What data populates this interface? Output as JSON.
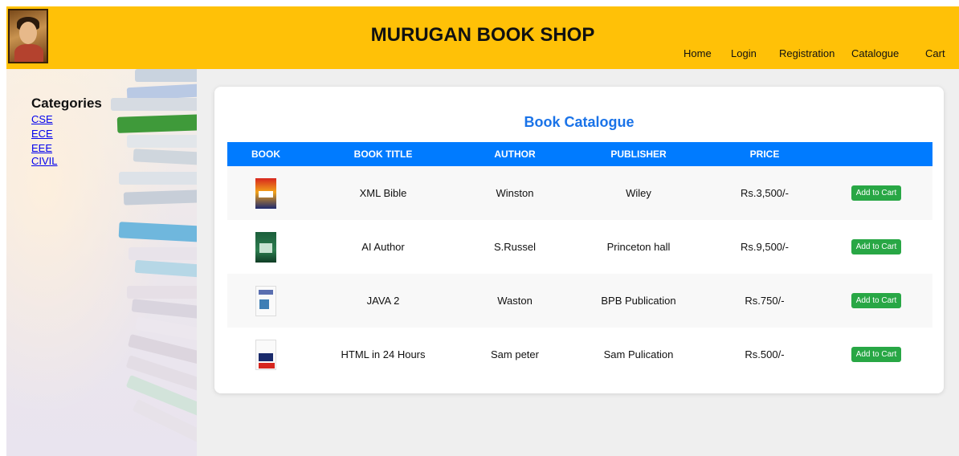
{
  "header": {
    "title": "MURUGAN BOOK SHOP",
    "nav": [
      "Home",
      "Login",
      "Registration",
      "Catalogue",
      "Cart"
    ],
    "background_color": "#ffc107"
  },
  "sidebar": {
    "title": "Categories",
    "categories": [
      "CSE",
      "ECE",
      "EEE",
      "CIVIL"
    ],
    "link_color": "#0000ee"
  },
  "catalogue": {
    "title": "Book Catalogue",
    "title_color": "#1a73e8",
    "header_color": "#007bff",
    "columns": [
      "BOOK",
      "BOOK TITLE",
      "AUTHOR",
      "PUBLISHER",
      "PRICE",
      ""
    ],
    "rows": [
      {
        "cover": "xml-bible-cover",
        "title": "XML Bible",
        "author": "Winston",
        "publisher": "Wiley",
        "price": "Rs.3,500/-",
        "action": "Add to Cart"
      },
      {
        "cover": "ai-author-cover",
        "title": "AI Author",
        "author": "S.Russel",
        "publisher": "Princeton hall",
        "price": "Rs.9,500/-",
        "action": "Add to Cart"
      },
      {
        "cover": "java-2-cover",
        "title": "JAVA 2",
        "author": "Waston",
        "publisher": "BPB Publication",
        "price": "Rs.750/-",
        "action": "Add to Cart"
      },
      {
        "cover": "html-24-hours-cover",
        "title": "HTML in 24 Hours",
        "author": "Sam peter",
        "publisher": "Sam Pulication",
        "price": "Rs.500/-",
        "action": "Add to Cart"
      }
    ],
    "button_color": "#28a745"
  }
}
